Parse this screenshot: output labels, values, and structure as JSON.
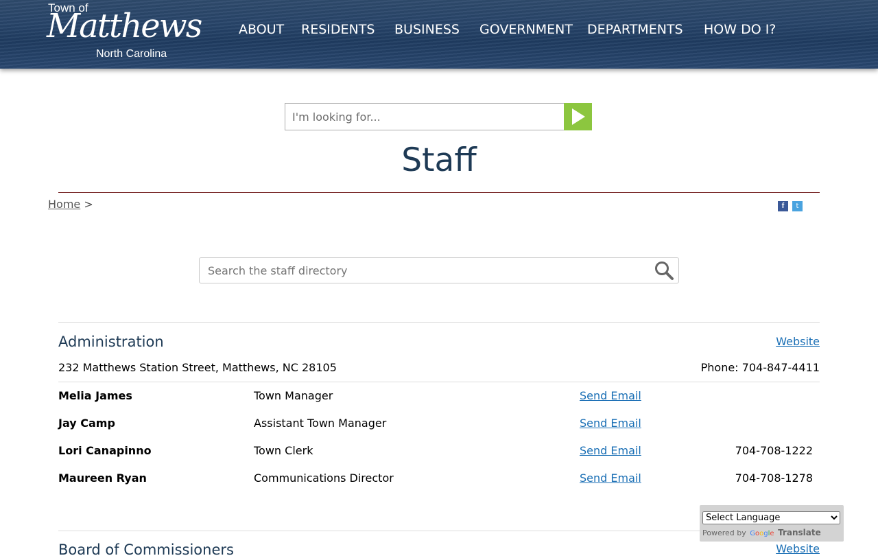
{
  "header": {
    "logo": {
      "top": "Town of",
      "main": "Matthews",
      "bottom": "North Carolina"
    },
    "nav": [
      "ABOUT",
      "RESIDENTS",
      "BUSINESS",
      "GOVERNMENT",
      "DEPARTMENTS",
      "HOW DO I?"
    ]
  },
  "site_search": {
    "placeholder": "I'm looking for..."
  },
  "page_title": "Staff",
  "breadcrumb": {
    "home": "Home",
    "sep": ">"
  },
  "social": {
    "facebook": "f",
    "twitter": "t"
  },
  "staff_search": {
    "placeholder": "Search the staff directory"
  },
  "departments": [
    {
      "name": "Administration",
      "website": "Website",
      "address": "232 Matthews Station Street, Matthews, NC 28105",
      "phone": "Phone: 704-847-4411",
      "staff": [
        {
          "name": "Melia James",
          "title": "Town Manager",
          "email": "Send Email",
          "phone": ""
        },
        {
          "name": "Jay Camp",
          "title": "Assistant Town Manager",
          "email": "Send Email",
          "phone": ""
        },
        {
          "name": "Lori Canapinno",
          "title": "Town Clerk",
          "email": "Send Email",
          "phone": "704-708-1222"
        },
        {
          "name": "Maureen Ryan",
          "title": "Communications Director",
          "email": "Send Email",
          "phone": "704-708-1278"
        }
      ]
    },
    {
      "name": "Board of Commissioners",
      "website": "Website"
    }
  ],
  "translate": {
    "select_label": "Select Language",
    "powered_by": "Powered by",
    "google": "Google",
    "translate": "Translate"
  }
}
